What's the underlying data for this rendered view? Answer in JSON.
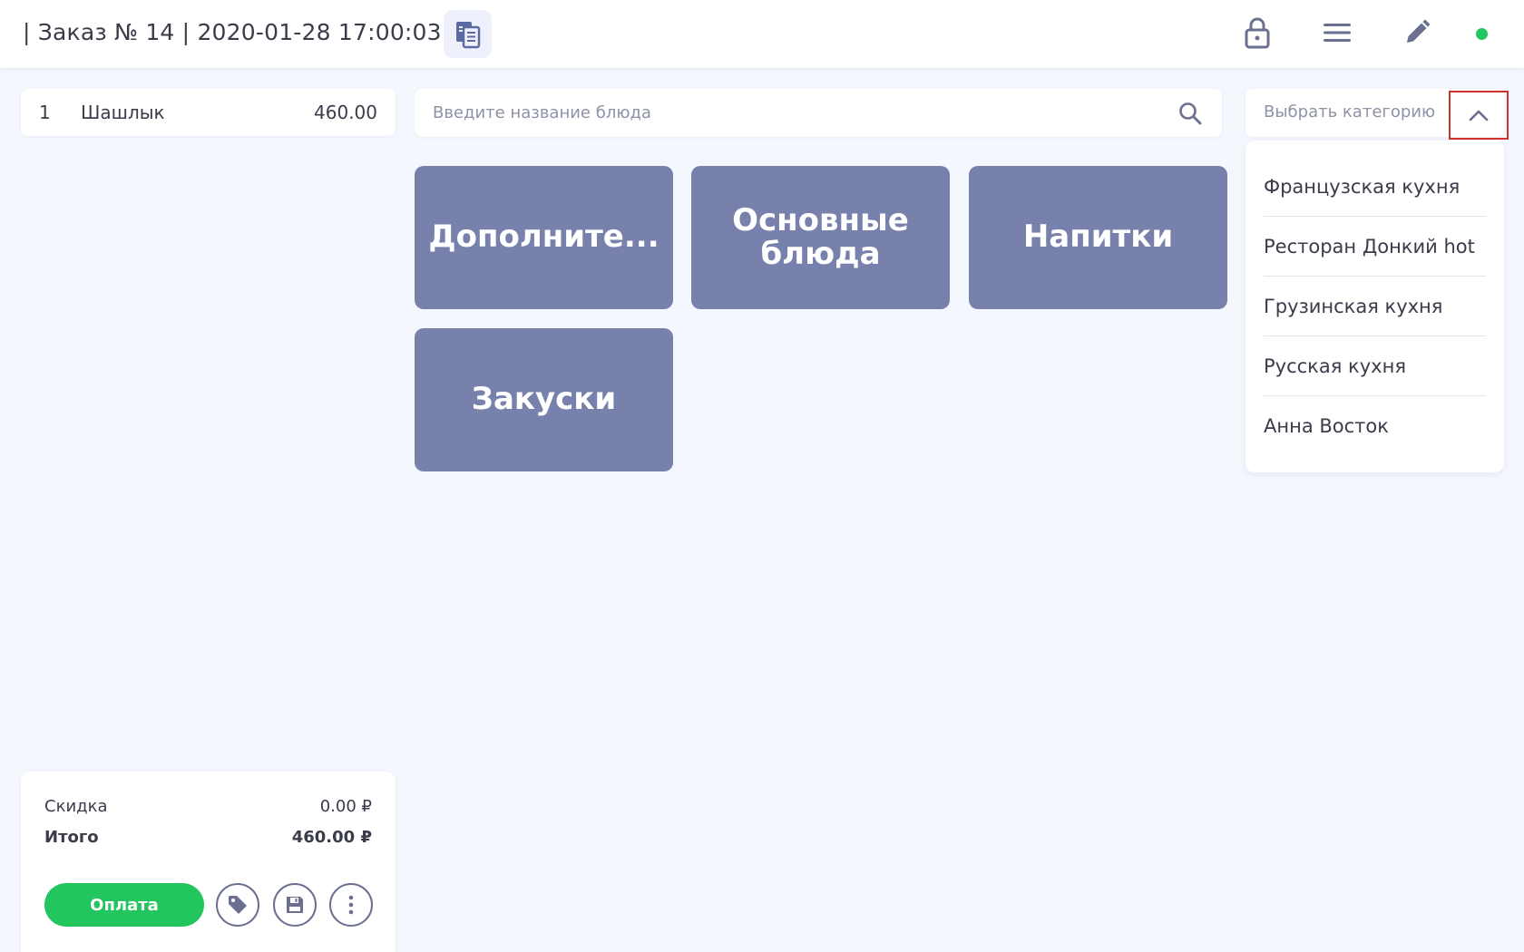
{
  "header": {
    "title": "| Заказ № 14 | 2020-01-28 17:00:03",
    "icons": [
      "document-icon",
      "lock-icon",
      "menu-icon",
      "pencil-icon"
    ],
    "status_color": "#22c55e"
  },
  "order": {
    "items": [
      {
        "qty": "1",
        "name": "Шашлык",
        "price": "460.00"
      }
    ]
  },
  "search": {
    "placeholder": "Введите название блюда"
  },
  "category_select": {
    "placeholder": "Выбрать категорию",
    "options": [
      "Французская кухня",
      "Ресторан Донкий hot",
      "Грузинская кухня",
      "Русская кухня",
      "Анна Восток"
    ]
  },
  "tiles": [
    "Дополните...",
    "Основные блюда",
    "Напитки",
    "Закуски"
  ],
  "summary": {
    "discount_label": "Скидка",
    "discount_value": "0.00 ₽",
    "total_label": "Итого",
    "total_value": "460.00 ₽",
    "pay_label": "Оплата"
  },
  "colors": {
    "accent": "#22c55e",
    "tile": "#7781ab",
    "background": "#f5f7fe",
    "highlight_border": "#d0312d"
  }
}
